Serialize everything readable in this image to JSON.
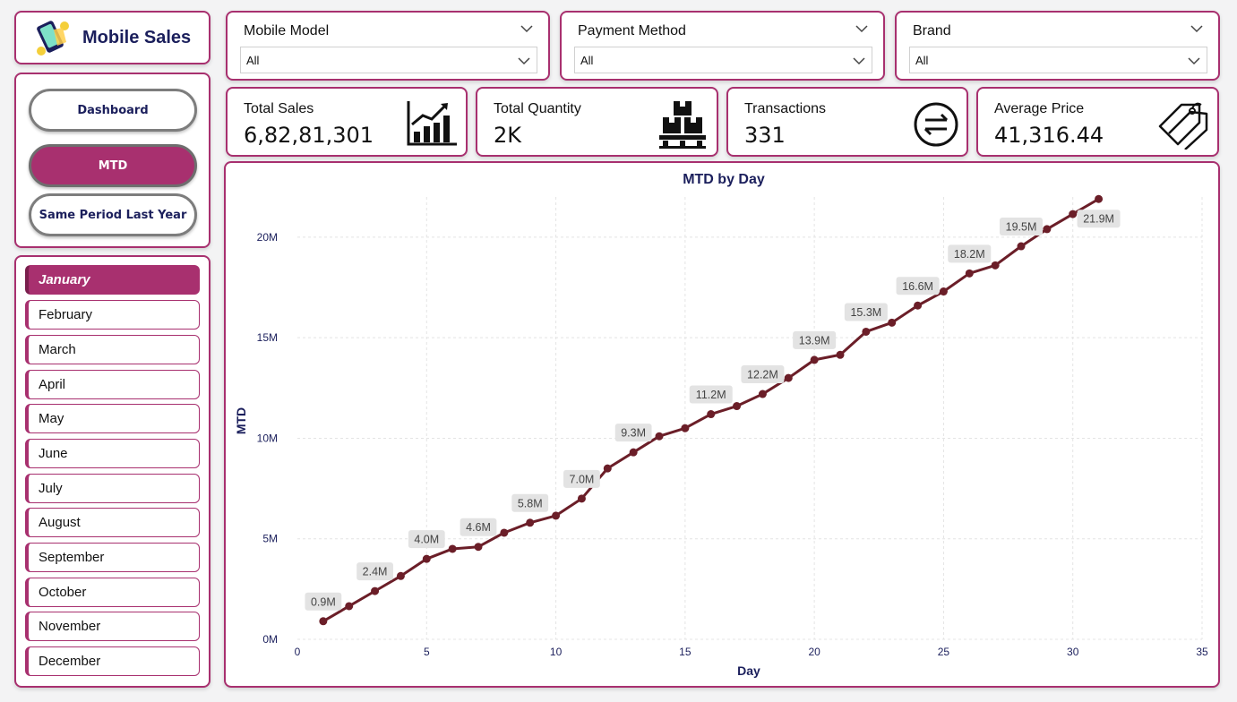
{
  "app": {
    "title": "Mobile Sales"
  },
  "nav": {
    "buttons": [
      {
        "label": "Dashboard",
        "active": false
      },
      {
        "label": "MTD",
        "active": true
      },
      {
        "label": "Same Period Last Year",
        "active": false
      }
    ]
  },
  "months": {
    "items": [
      "January",
      "February",
      "March",
      "April",
      "May",
      "June",
      "July",
      "August",
      "September",
      "October",
      "November",
      "December"
    ],
    "selected": "January"
  },
  "filters": [
    {
      "label": "Mobile Model",
      "value": "All"
    },
    {
      "label": "Payment Method",
      "value": "All"
    },
    {
      "label": "Brand",
      "value": "All"
    }
  ],
  "kpis": [
    {
      "label": "Total Sales",
      "value": "6,82,81,301",
      "icon": "bar-chart-growth-icon"
    },
    {
      "label": "Total Quantity",
      "value": "2K",
      "icon": "boxes-pallet-icon"
    },
    {
      "label": "Transactions",
      "value": "331",
      "icon": "exchange-arrows-icon"
    },
    {
      "label": "Average Price",
      "value": "41,316.44",
      "icon": "price-tags-icon"
    }
  ],
  "colors": {
    "accent": "#a8306f",
    "navy": "#1b1f5c",
    "line": "#6b1e28"
  },
  "chart_data": {
    "type": "line",
    "title": "MTD by Day",
    "xlabel": "Day",
    "ylabel": "MTD",
    "xlim": [
      0,
      35
    ],
    "ylim": [
      0,
      22000000
    ],
    "x_ticks": [
      0,
      5,
      10,
      15,
      20,
      25,
      30,
      35
    ],
    "y_ticks": [
      {
        "value": 0,
        "label": "0M"
      },
      {
        "value": 5000000,
        "label": "5M"
      },
      {
        "value": 10000000,
        "label": "10M"
      },
      {
        "value": 15000000,
        "label": "15M"
      },
      {
        "value": 20000000,
        "label": "20M"
      }
    ],
    "grid": true,
    "x": [
      1,
      2,
      3,
      4,
      5,
      6,
      7,
      8,
      9,
      10,
      11,
      12,
      13,
      14,
      15,
      16,
      17,
      18,
      19,
      20,
      21,
      22,
      23,
      24,
      25,
      26,
      27,
      28,
      29,
      30,
      31
    ],
    "values": [
      900000,
      1650000,
      2400000,
      3150000,
      4000000,
      4500000,
      4600000,
      5300000,
      5800000,
      6150000,
      7000000,
      8500000,
      9300000,
      10100000,
      10500000,
      11200000,
      11600000,
      12200000,
      13000000,
      13900000,
      14150000,
      15300000,
      15750000,
      16600000,
      17300000,
      18200000,
      18600000,
      19550000,
      20400000,
      21150000,
      21900000
    ],
    "data_labels": [
      {
        "x": 1,
        "text": "0.9M"
      },
      {
        "x": 3,
        "text": "2.4M"
      },
      {
        "x": 5,
        "text": "4.0M"
      },
      {
        "x": 7,
        "text": "4.6M"
      },
      {
        "x": 9,
        "text": "5.8M"
      },
      {
        "x": 11,
        "text": "7.0M"
      },
      {
        "x": 13,
        "text": "9.3M"
      },
      {
        "x": 16,
        "text": "11.2M"
      },
      {
        "x": 18,
        "text": "12.2M"
      },
      {
        "x": 20,
        "text": "13.9M"
      },
      {
        "x": 22,
        "text": "15.3M"
      },
      {
        "x": 24,
        "text": "16.6M"
      },
      {
        "x": 26,
        "text": "18.2M"
      },
      {
        "x": 28,
        "text": "19.5M"
      },
      {
        "x": 31,
        "text": "21.9M"
      }
    ]
  }
}
